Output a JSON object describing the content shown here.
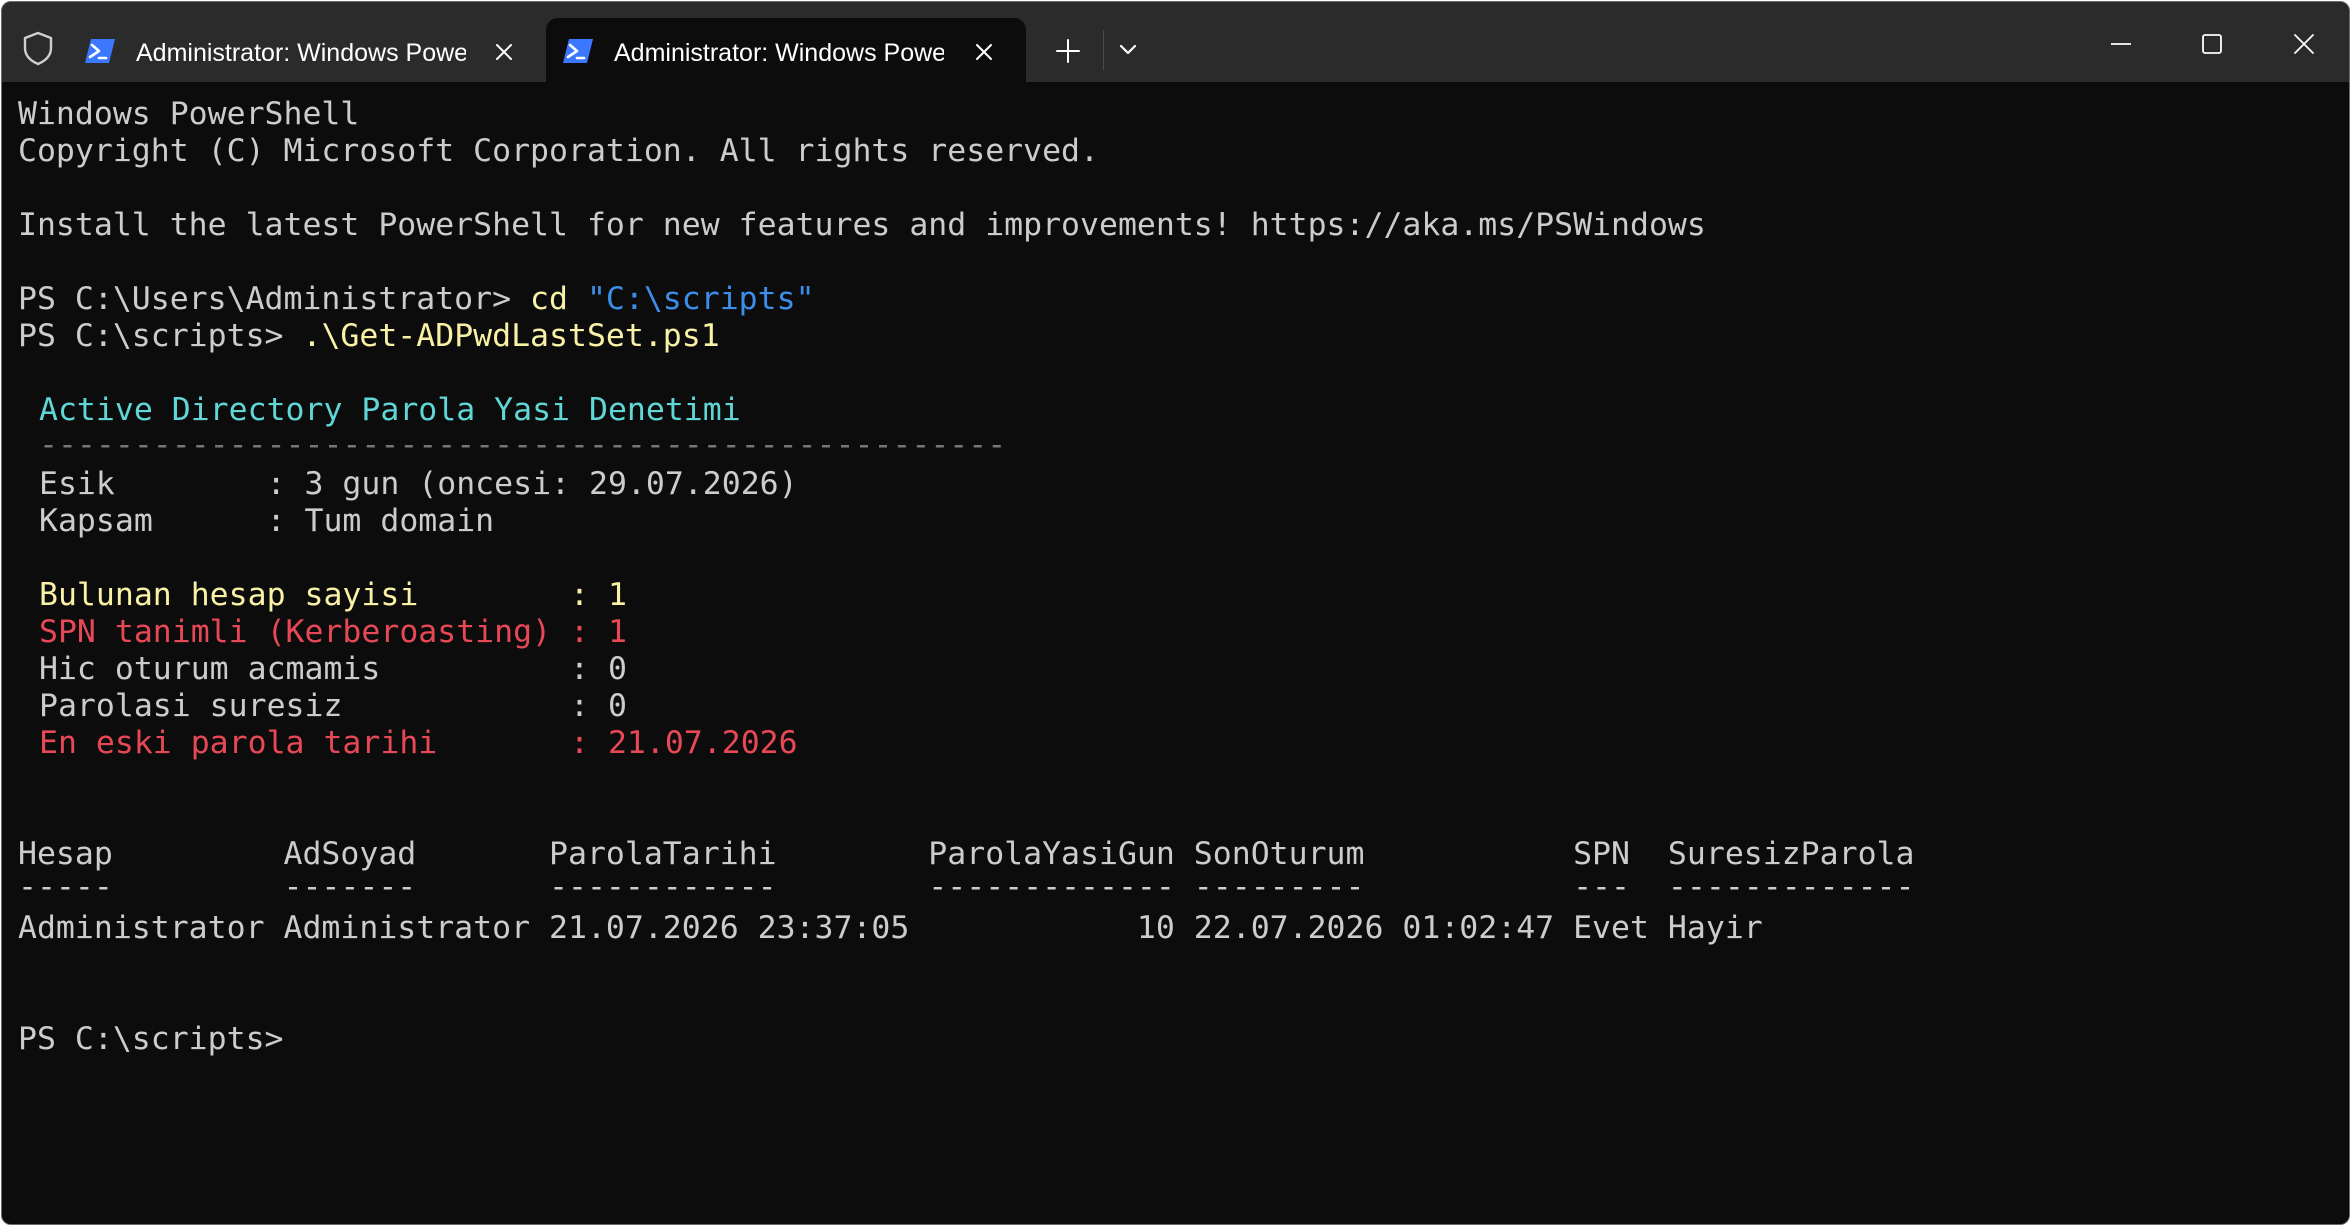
{
  "window": {
    "tabs": [
      {
        "label": "Administrator: Windows PowerShell",
        "active": false
      },
      {
        "label": "Administrator: Windows PowerShell",
        "active": true
      }
    ],
    "accent_color": "#3b78ff"
  },
  "terminal": {
    "banner_title": "Windows PowerShell",
    "banner_copyright": "Copyright (C) Microsoft Corporation. All rights reserved.",
    "banner_install": "Install the latest PowerShell for new features and improvements! https://aka.ms/PSWindows",
    "cmd1_prompt": "PS C:\\Users\\Administrator> ",
    "cmd1_command": "cd",
    "cmd1_arg": "\"C:\\scripts\"",
    "cmd2_prompt": "PS C:\\scripts> ",
    "cmd2_command": ".\\Get-ADPwdLastSet.ps1",
    "report_title": "Active Directory Parola Yasi Denetimi",
    "report_rule": "---------------------------------------------------",
    "threshold_line": "Esik        : 3 gun (oncesi: 29.07.2026)",
    "scope_line": "Kapsam      : Tum domain",
    "found_accounts_line": "Bulunan hesap sayisi        : 1",
    "spn_line": "SPN tanimli (Kerberoasting) : 1",
    "never_logon_line": "Hic oturum acmamis          : 0",
    "no_expiry_line": "Parolasi suresiz            : 0",
    "oldest_pwd_line": "En eski parola tarihi       : 21.07.2026",
    "table_header": "Hesap         AdSoyad       ParolaTarihi        ParolaYasiGun SonOturum           SPN  SuresizParola",
    "table_underline": "-----         -------       ------------        ------------- ---------           ---  -------------",
    "table_row": "Administrator Administrator 21.07.2026 23:37:05            10 22.07.2026 01:02:47 Evet Hayir",
    "final_prompt": "PS C:\\scripts>"
  }
}
